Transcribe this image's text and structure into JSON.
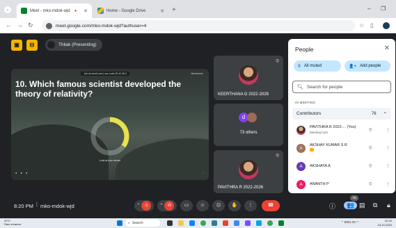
{
  "browser": {
    "tabs": [
      {
        "title": "Meet - mko-mdok-wjd",
        "active": true
      },
      {
        "title": "Home - Google Drive",
        "active": false
      }
    ],
    "url": "meet.google.com/mko-mdok-wjd?authuser=4"
  },
  "meeting": {
    "presenter_label": "Thilak (Presenting)",
    "time": "8:20 PM",
    "code": "mko-mdok-wjd"
  },
  "slide": {
    "join_banner": "Join at menti.com | use code 25 42 66 5",
    "brand": "Mentimeter",
    "question": "10. Which famous scientist developed the theory of relativity?",
    "hint": "Look at your device",
    "donut_fraction": 0.35,
    "donut_color": "#e8e24a"
  },
  "tiles": [
    {
      "name": "KEERTHANA G 2022-2026"
    },
    {
      "name": "73 others",
      "initial": "d"
    },
    {
      "name": "PAVITHRA R 2022-2026"
    }
  ],
  "people_panel": {
    "title": "People",
    "all_muted_label": "All muted",
    "add_people_label": "Add people",
    "search_placeholder": "Search for people",
    "section_label": "IN MEETING",
    "group_label": "Contributors",
    "group_count": "76",
    "participants": [
      {
        "name": "PAVITHRA R 2022-... (You)",
        "sub": "Meeting host",
        "initial": "",
        "color": "#c2477b"
      },
      {
        "name": "AKSHAY KUMAR S R",
        "sub": "",
        "initial": "A",
        "color": "#a0705a"
      },
      {
        "name": "AKSHAYA A",
        "sub": "",
        "initial": "A",
        "color": "#673ab7"
      },
      {
        "name": "ANANTH P",
        "sub": "",
        "initial": "A",
        "color": "#e91e63"
      }
    ]
  },
  "controls": {
    "people_count": "76"
  },
  "taskbar": {
    "weather_temp": "29°C",
    "weather_desc": "Rain showers",
    "search_label": "Search",
    "lang": "ENG",
    "region": "IN",
    "time": "20:20",
    "date": "24-10-2024"
  },
  "icons": {
    "mic_off": "mic-off-icon",
    "camera_off": "camera-off-icon",
    "end_call": "end-call-icon",
    "people": "people-icon",
    "chat": "chat-icon"
  }
}
